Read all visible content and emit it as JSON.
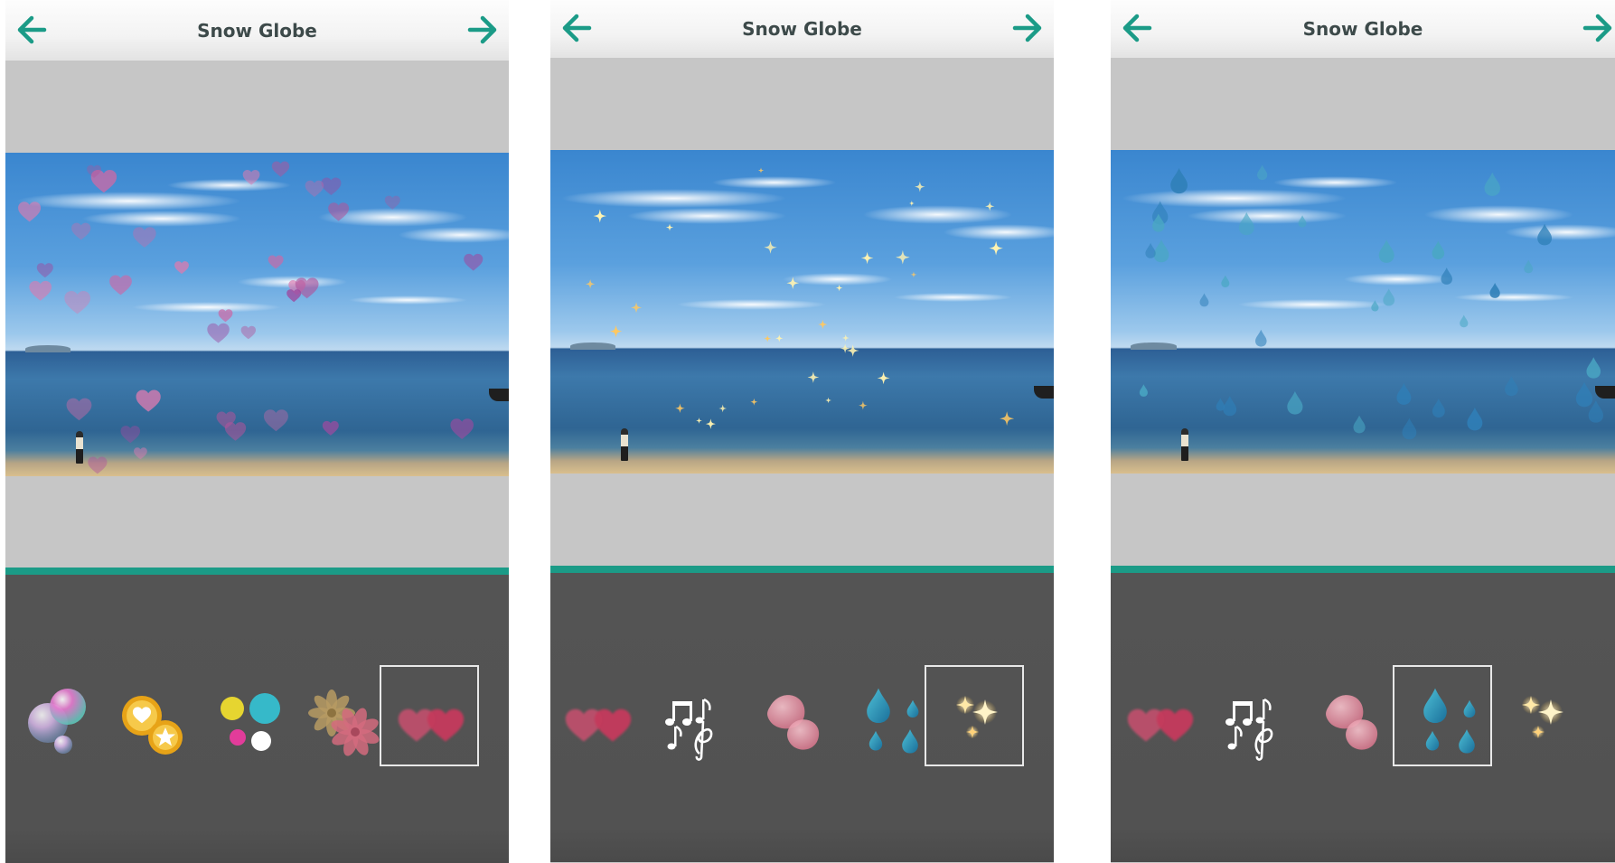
{
  "colors": {
    "accent": "#1b9b87",
    "topbar": "#f3f3f3",
    "panel": "#525252",
    "letterbox": "#c6c6c6"
  },
  "screens": [
    {
      "title": "Snow Globe",
      "back_icon": "arrow-left-icon",
      "next_icon": "arrow-right-icon",
      "active_effect": "hearts",
      "effects": [
        "bubbles",
        "heart-star-badges",
        "colored-dots",
        "flowers",
        "hearts"
      ],
      "selected_effect": "hearts"
    },
    {
      "title": "Snow Globe",
      "back_icon": "arrow-left-icon",
      "next_icon": "arrow-right-icon",
      "active_effect": "sparkles",
      "effects": [
        "hearts",
        "music-notes",
        "petals",
        "water-drops",
        "sparkles"
      ],
      "selected_effect": "sparkles"
    },
    {
      "title": "Snow Globe",
      "back_icon": "arrow-left-icon",
      "next_icon": "arrow-right-icon",
      "active_effect": "water-drops",
      "effects": [
        "hearts",
        "music-notes",
        "petals",
        "water-drops",
        "sparkles"
      ],
      "selected_effect": "water-drops"
    }
  ]
}
